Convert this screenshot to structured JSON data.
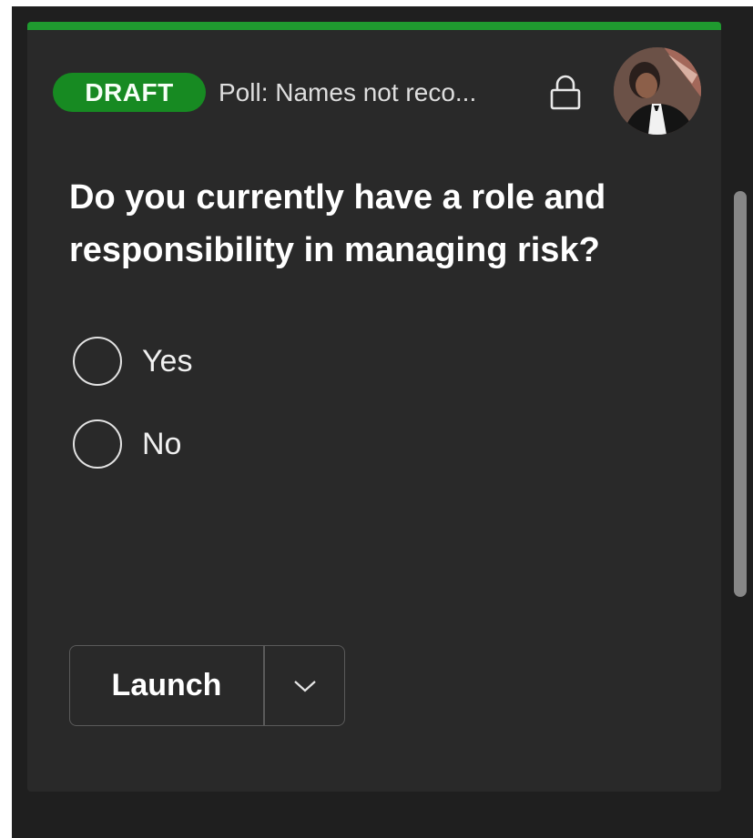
{
  "card": {
    "badge": "DRAFT",
    "poll_title": "Poll: Names not reco...",
    "question": "Do you currently have a role and responsibility in managing risk?",
    "options": [
      {
        "label": "Yes"
      },
      {
        "label": "No"
      }
    ],
    "launch_label": "Launch"
  },
  "icons": {
    "lock": "lock-icon",
    "avatar": "avatar-photo",
    "chevron": "chevron-down-icon"
  },
  "colors": {
    "accent": "#1f9a2f",
    "badge_bg": "#178a22",
    "card_bg": "#292929",
    "panel_bg": "#1f1f1f"
  }
}
